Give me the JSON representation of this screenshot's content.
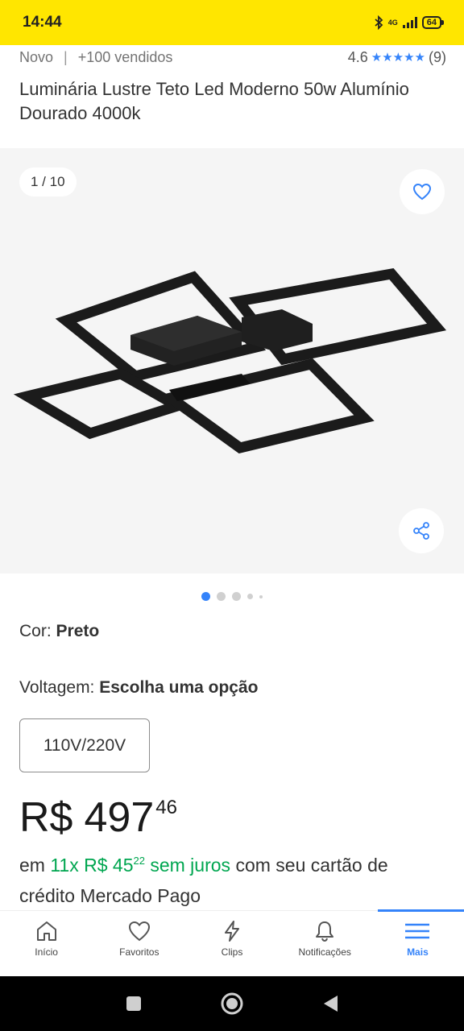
{
  "status": {
    "time": "14:44",
    "network": "4G",
    "battery": "64"
  },
  "product": {
    "condition": "Novo",
    "sold": "+100 vendidos",
    "rating_value": "4.6",
    "rating_count": "(9)",
    "stars": "★★★★★",
    "title": "Luminária Lustre Teto Led Moderno 50w Alumínio Dourado 4000k"
  },
  "gallery": {
    "counter": "1 / 10",
    "dots_total": 5,
    "active_dot": 1
  },
  "variations": {
    "color_label": "Cor:",
    "color_value": "Preto",
    "voltage_label": "Voltagem:",
    "voltage_value": "Escolha uma opção",
    "voltage_option": "110V/220V"
  },
  "price": {
    "currency": "R$",
    "integer": "497",
    "cents": "46",
    "installment_prefix": "em",
    "installment_count": "11x R$ 45",
    "installment_cents": "22",
    "installment_interest": "sem juros",
    "installment_suffix": "com seu cartão de crédito Mercado Pago"
  },
  "bottom_nav": [
    {
      "label": "Início",
      "icon": "home-icon"
    },
    {
      "label": "Favoritos",
      "icon": "heart-icon"
    },
    {
      "label": "Clips",
      "icon": "lightning-icon"
    },
    {
      "label": "Notificações",
      "icon": "bell-icon"
    },
    {
      "label": "Mais",
      "icon": "menu-icon",
      "active": true
    }
  ],
  "colors": {
    "brand_yellow": "#ffe600",
    "accent_blue": "#3483fa",
    "green": "#00a650"
  }
}
